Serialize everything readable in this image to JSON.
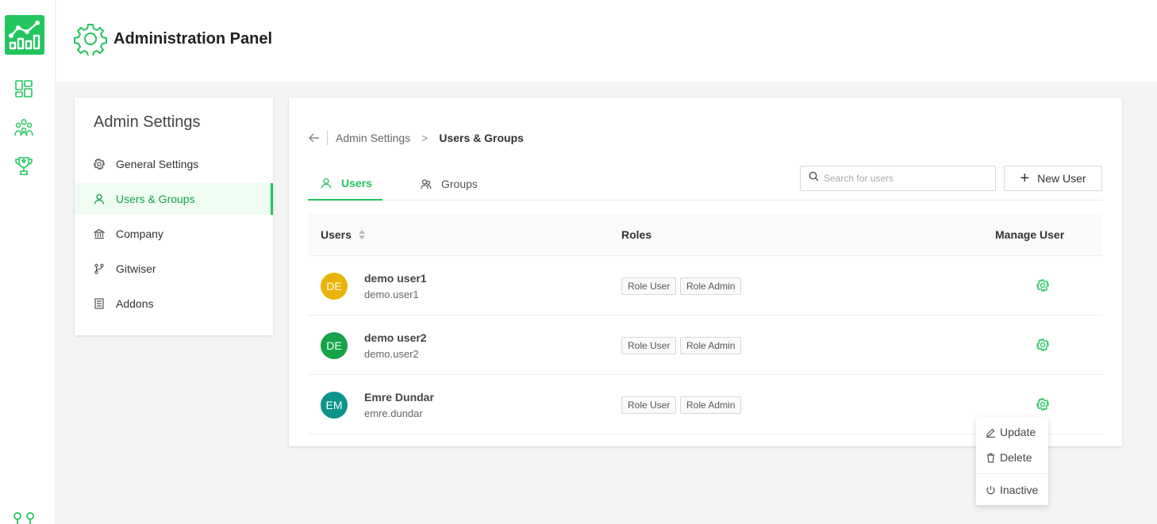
{
  "header": {
    "title": "Administration Panel"
  },
  "colors": {
    "accent": "#22c55e",
    "avatar_yellow": "#eab308",
    "avatar_green": "#16a34a",
    "avatar_teal": "#0d9488"
  },
  "settings": {
    "title": "Admin Settings",
    "items": [
      {
        "label": "General Settings",
        "icon": "gear-icon"
      },
      {
        "label": "Users & Groups",
        "icon": "user-icon"
      },
      {
        "label": "Company",
        "icon": "bank-icon"
      },
      {
        "label": "Gitwiser",
        "icon": "branch-icon"
      },
      {
        "label": "Addons",
        "icon": "addons-icon"
      }
    ]
  },
  "breadcrumb": {
    "parent": "Admin Settings",
    "separator": ">",
    "current": "Users & Groups"
  },
  "tabs": [
    {
      "label": "Users"
    },
    {
      "label": "Groups"
    }
  ],
  "search": {
    "placeholder": "Search for users"
  },
  "new_user_label": "New User",
  "table": {
    "columns": [
      "Users",
      "Roles",
      "Manage User"
    ],
    "rows": [
      {
        "initials": "DE",
        "name": "demo user1",
        "login": "demo.user1",
        "roles": [
          "Role User",
          "Role Admin"
        ]
      },
      {
        "initials": "DE",
        "name": "demo user2",
        "login": "demo.user2",
        "roles": [
          "Role User",
          "Role Admin"
        ]
      },
      {
        "initials": "EM",
        "name": "Emre Dundar",
        "login": "emre.dundar",
        "roles": [
          "Role User",
          "Role Admin"
        ]
      }
    ]
  },
  "dropdown": {
    "items": [
      {
        "label": "Update"
      },
      {
        "label": "Delete"
      },
      {
        "label": "Inactive"
      }
    ]
  }
}
